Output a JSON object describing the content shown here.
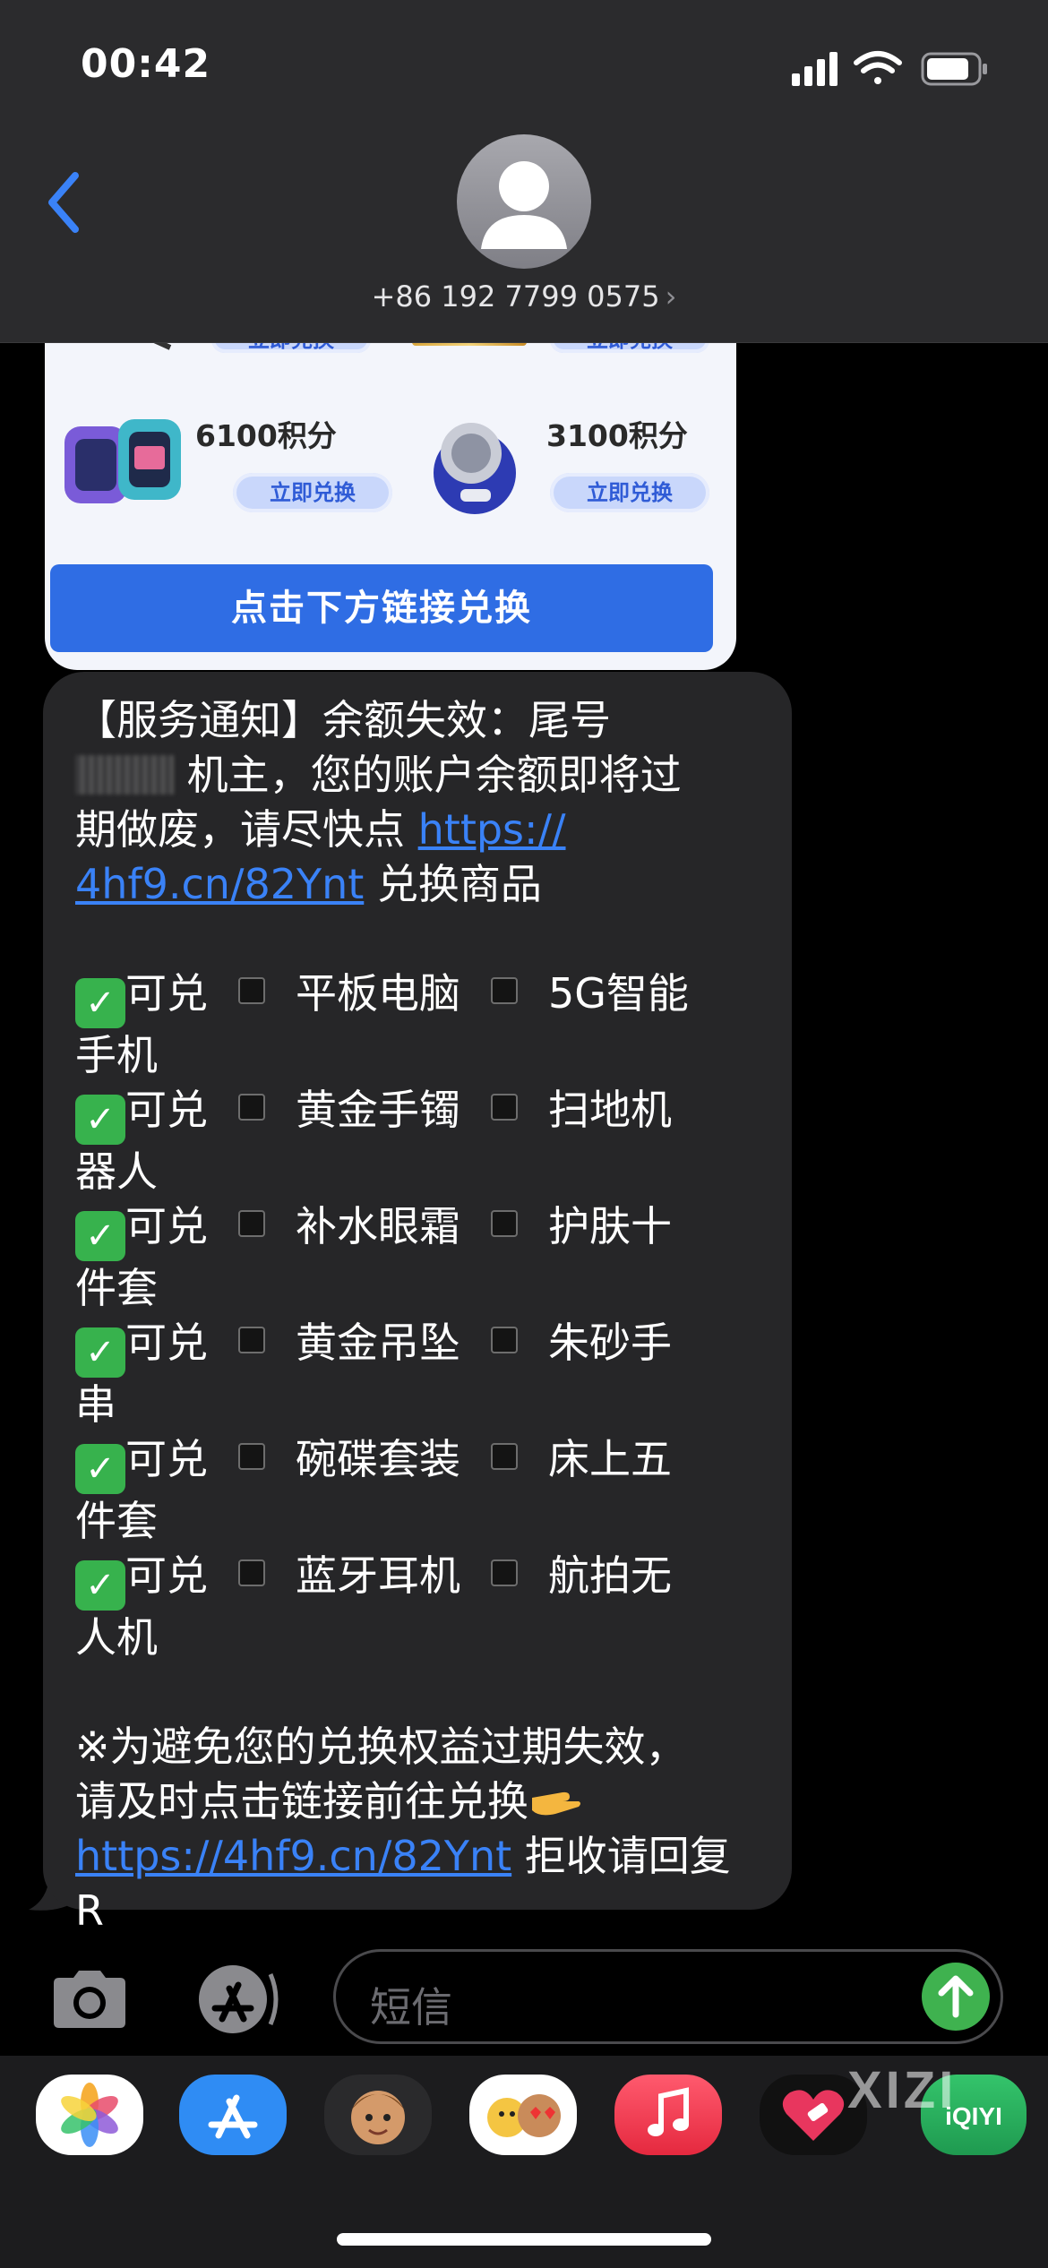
{
  "status_bar": {
    "time": "00:42"
  },
  "header": {
    "contact": "+86 192 7799 0575",
    "chevron": "›"
  },
  "image_card": {
    "products": [
      {
        "points": "6100积分",
        "button": "立即兑换"
      },
      {
        "points": "3100积分",
        "button": "立即兑换"
      }
    ],
    "top_buttons": [
      "立即兑换",
      "立即兑换"
    ],
    "cta": "点击下方链接兑换"
  },
  "message": {
    "line1": "【服务通知】余额失效：尾号",
    "line2": "机主，您的账户余额即将过",
    "line3_text": "期做废，请尽快点 ",
    "link_part1": "https://",
    "link_part2": "4hf9.cn/82Ynt",
    "line4_tail": " 兑换商品",
    "items": [
      {
        "label": "可兑",
        "a": "平板电脑",
        "b": "5G智能",
        "wrap": "手机"
      },
      {
        "label": "可兑",
        "a": "黄金手镯",
        "b": "扫地机",
        "wrap": "器人"
      },
      {
        "label": "可兑",
        "a": "补水眼霜",
        "b": "护肤十",
        "wrap": "件套"
      },
      {
        "label": "可兑",
        "a": "黄金吊坠",
        "b": "朱砂手",
        "wrap": "串"
      },
      {
        "label": "可兑",
        "a": "碗碟套装",
        "b": "床上五",
        "wrap": "件套"
      },
      {
        "label": "可兑",
        "a": "蓝牙耳机",
        "b": "航拍无",
        "wrap": "人机"
      }
    ],
    "check_glyph": "✓",
    "note1": "※为避免您的兑换权益过期失效，",
    "note2": "请及时点击链接前往兑换",
    "link_full": "https://4hf9.cn/82Ynt",
    "reply_text": " 拒收请回复",
    "reply_code": "R"
  },
  "input": {
    "placeholder": "短信"
  },
  "tray_apps": [
    "photos-icon",
    "app-store-icon",
    "memoji-icon",
    "animoji-icon",
    "music-icon",
    "heart-icon",
    "iqiyi-icon"
  ],
  "tray_labels": {
    "iqiyi": "iQIYI"
  },
  "watermark": "XIZI",
  "colors": {
    "link": "#3a82f7",
    "bubble": "#262628",
    "cta": "#2f6de4",
    "send": "#3fb24f"
  }
}
